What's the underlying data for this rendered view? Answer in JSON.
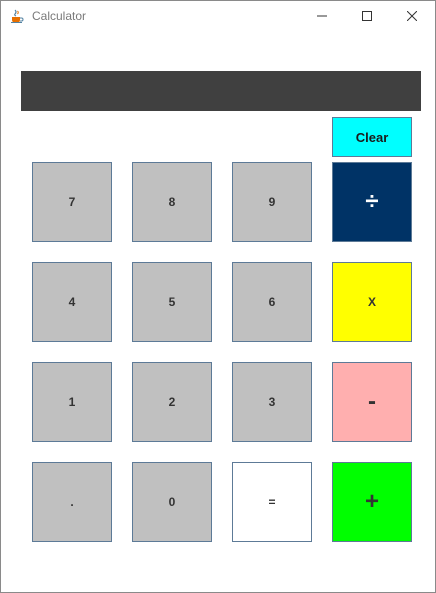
{
  "window": {
    "title": "Calculator",
    "app_icon": "java-coffee-cup-icon",
    "controls": [
      "minimize-icon",
      "maximize-icon",
      "close-icon"
    ]
  },
  "display": {
    "value": ""
  },
  "buttons": {
    "clear": "Clear",
    "seven": "7",
    "eight": "8",
    "nine": "9",
    "divide": "÷",
    "four": "4",
    "five": "5",
    "six": "6",
    "multiply": "X",
    "one": "1",
    "two": "2",
    "three": "3",
    "subtract": "-",
    "dot": ".",
    "zero": "0",
    "equals": "=",
    "add": "+"
  },
  "colors": {
    "display_bg": "#404040",
    "digit_bg": "#c0c0c0",
    "clear_bg": "#00ffff",
    "divide_bg": "#003366",
    "multiply_bg": "#ffff00",
    "subtract_bg": "#ffafaf",
    "add_bg": "#00ff00",
    "equals_bg": "#ffffff",
    "border": "#5d7a97"
  }
}
